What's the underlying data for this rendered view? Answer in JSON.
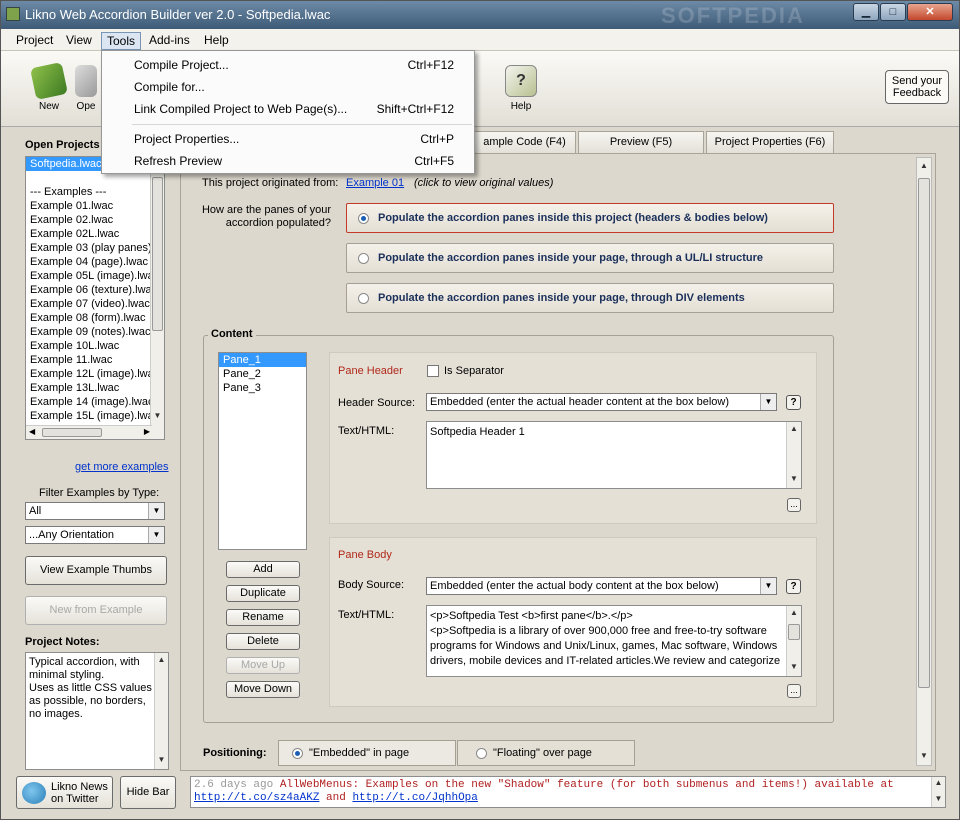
{
  "window": {
    "title": "Likno Web Accordion Builder ver 2.0 - Softpedia.lwac",
    "watermark": "SOFTPEDIA",
    "controls": {
      "minimize": "▁",
      "maximize": "□",
      "close": "✕"
    }
  },
  "menubar": [
    "Project",
    "View",
    "Tools",
    "Add-ins",
    "Help"
  ],
  "tools_menu": {
    "items": [
      {
        "label": "Compile Project...",
        "shortcut": "Ctrl+F12"
      },
      {
        "label": "Compile for...",
        "shortcut": ""
      },
      {
        "label": "Link Compiled Project to Web Page(s)...",
        "shortcut": "Shift+Ctrl+F12"
      },
      {
        "label": "Project Properties...",
        "shortcut": "Ctrl+P"
      },
      {
        "label": "Refresh Preview",
        "shortcut": "Ctrl+F5"
      }
    ]
  },
  "toolbar": {
    "new_label": "New",
    "open_label": "Ope",
    "help_label": "Help",
    "feedback_line1": "Send your",
    "feedback_line2": "Feedback"
  },
  "left": {
    "open_projects_label": "Open Projects",
    "projects": [
      "Softpedia.lwac",
      "",
      "--- Examples ---",
      "Example 01.lwac",
      "Example 02.lwac",
      "Example 02L.lwac",
      "Example 03 (play panes)",
      "Example 04 (page).lwac",
      "Example 05L (image).lwa",
      "Example 06 (texture).lwa",
      "Example 07 (video).lwac",
      "Example 08 (form).lwac",
      "Example 09 (notes).lwac",
      "Example 10L.lwac",
      "Example 11.lwac",
      "Example 12L (image).lwa",
      "Example 13L.lwac",
      "Example 14 (image).lwac",
      "Example 15L (image).lwa",
      "Example 16 (image).lwa"
    ],
    "get_more": "get more examples",
    "filter_label": "Filter Examples by Type:",
    "filter_type": "All",
    "filter_orientation": "...Any Orientation",
    "view_thumbs": "View Example Thumbs",
    "new_from_example": "New from Example",
    "notes_label": "Project Notes:",
    "notes_text": "Typical accordion, with minimal styling.\nUses as little CSS values as possible, no borders, no images."
  },
  "tabs": [
    {
      "label": "ample Code  (F4)"
    },
    {
      "label": "Preview    (F5)"
    },
    {
      "label": "Project Properties   (F6)"
    }
  ],
  "main": {
    "originated_label": "This project originated from:",
    "originated_link": "Example 01",
    "originated_hint": "(click to view original values)",
    "question_line1": "How are the panes of your",
    "question_line2": "accordion populated?",
    "options": [
      {
        "label": "Populate the accordion panes inside this project (headers & bodies below)",
        "selected": true
      },
      {
        "label": "Populate the accordion panes inside your page, through a UL/LI structure",
        "selected": false
      },
      {
        "label": "Populate the accordion panes inside your page, through DIV elements",
        "selected": false
      }
    ],
    "content_label": "Content",
    "panes": [
      "Pane_1",
      "Pane_2",
      "Pane_3"
    ],
    "pane_buttons": [
      {
        "label": "Add",
        "enabled": true
      },
      {
        "label": "Duplicate",
        "enabled": true
      },
      {
        "label": "Rename",
        "enabled": true
      },
      {
        "label": "Delete",
        "enabled": true
      },
      {
        "label": "Move Up",
        "enabled": false
      },
      {
        "label": "Move Down",
        "enabled": true
      }
    ],
    "pane_header": {
      "title": "Pane Header",
      "is_separator": "Is Separator",
      "source_label": "Header Source:",
      "source_value": "Embedded   (enter the actual header content at the box below)",
      "text_label": "Text/HTML:",
      "text_value": "Softpedia Header 1"
    },
    "pane_body": {
      "title": "Pane Body",
      "source_label": "Body Source:",
      "source_value": "Embedded   (enter the actual body content at the box below)",
      "text_label": "Text/HTML:",
      "lines": [
        "<p>Softpedia Test <b>first pane</b>.</p>",
        "<p>Softpedia is a library of over 900,000 free and free-to-try software",
        "programs for Windows and Unix/Linux, games, Mac software, Windows",
        "drivers, mobile devices and IT-related articles.We review and categorize"
      ]
    },
    "positioning_label": "Positioning:",
    "positioning_embedded": "\"Embedded\" in page",
    "positioning_floating": "\"Floating\" over page"
  },
  "bottom": {
    "news_line1": "Likno News",
    "news_line2": "on Twitter",
    "hide_bar": "Hide Bar",
    "tweet1_time": "2.6 days ago",
    "tweet1_text": "AllWebMenus: Examples on the new \"Shadow\" feature (for both submenus and items!) available at",
    "tweet1_link1": "http://t.co/sz4aAKZ",
    "tweet1_and": "and",
    "tweet1_link2": "http://t.co/JqhhOpa"
  }
}
